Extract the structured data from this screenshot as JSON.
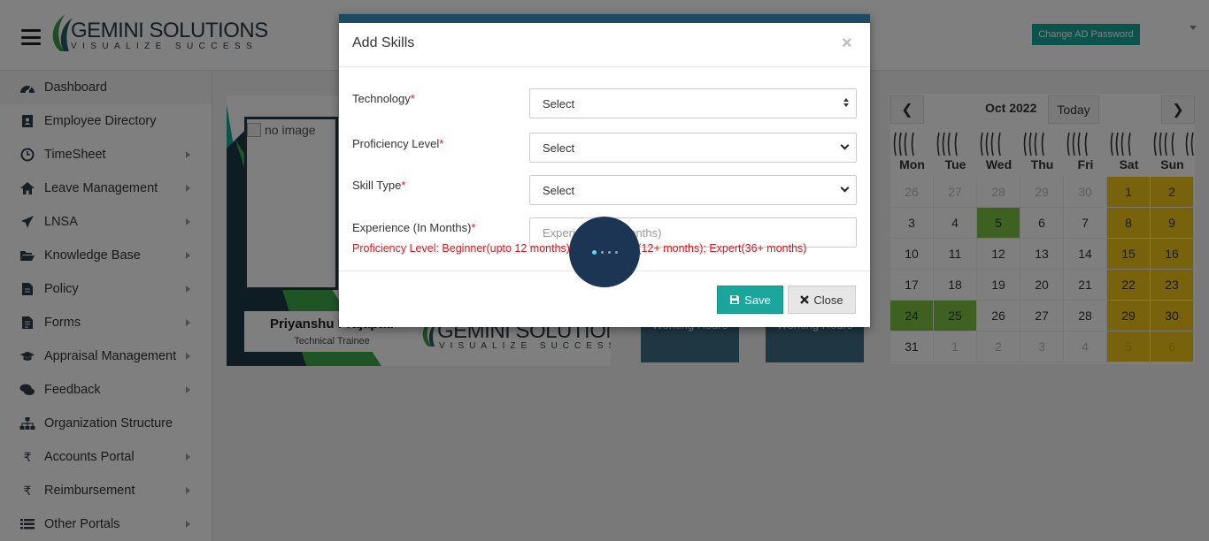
{
  "header": {
    "brand": "GEMINI SOLUTIONS",
    "tagline": "VISUALIZE SUCCESS",
    "change_password_label": "Change AD Password"
  },
  "sidebar": {
    "items": [
      {
        "label": "Dashboard",
        "icon": "dashboard-icon",
        "has_submenu": false
      },
      {
        "label": "Employee Directory",
        "icon": "address-book-icon",
        "has_submenu": false
      },
      {
        "label": "TimeSheet",
        "icon": "clock-icon",
        "has_submenu": true
      },
      {
        "label": "Leave Management",
        "icon": "home-icon",
        "has_submenu": true
      },
      {
        "label": "LNSA",
        "icon": "paper-plane-icon",
        "has_submenu": true
      },
      {
        "label": "Knowledge Base",
        "icon": "folder-open-icon",
        "has_submenu": true
      },
      {
        "label": "Policy",
        "icon": "file-icon",
        "has_submenu": true
      },
      {
        "label": "Forms",
        "icon": "file-text-icon",
        "has_submenu": true
      },
      {
        "label": "Appraisal Management",
        "icon": "graduation-cap-icon",
        "has_submenu": true
      },
      {
        "label": "Feedback",
        "icon": "comments-icon",
        "has_submenu": true
      },
      {
        "label": "Organization Structure",
        "icon": "sitemap-icon",
        "has_submenu": false
      },
      {
        "label": "Accounts Portal",
        "icon": "rupee-icon",
        "has_submenu": true
      },
      {
        "label": "Reimbursement",
        "icon": "rupee-icon",
        "has_submenu": true
      },
      {
        "label": "Other Portals",
        "icon": "list-icon",
        "has_submenu": true
      }
    ]
  },
  "profile": {
    "photo_alt": "no image",
    "name": "Priyanshu Prajapati",
    "role": "Technical Trainee"
  },
  "tiles": [
    {
      "label": "Working Hours"
    },
    {
      "label": "Working Hours"
    }
  ],
  "calendar": {
    "month_label": "Oct 2022",
    "today_label": "Today",
    "prev_glyph": "❮",
    "next_glyph": "❯",
    "weekdays": [
      "Mon",
      "Tue",
      "Wed",
      "Thu",
      "Fri",
      "Sat",
      "Sun"
    ],
    "colors": {
      "weekend": "#f0c419",
      "highlight": "#7dc242"
    },
    "weeks": [
      [
        {
          "d": "26",
          "other": true
        },
        {
          "d": "27",
          "other": true
        },
        {
          "d": "28",
          "other": true
        },
        {
          "d": "29",
          "other": true
        },
        {
          "d": "30",
          "other": true
        },
        {
          "d": "1",
          "weekend": true
        },
        {
          "d": "2",
          "weekend": true
        }
      ],
      [
        {
          "d": "3"
        },
        {
          "d": "4"
        },
        {
          "d": "5",
          "highlight": true
        },
        {
          "d": "6"
        },
        {
          "d": "7"
        },
        {
          "d": "8",
          "weekend": true
        },
        {
          "d": "9",
          "weekend": true
        }
      ],
      [
        {
          "d": "10"
        },
        {
          "d": "11"
        },
        {
          "d": "12"
        },
        {
          "d": "13"
        },
        {
          "d": "14"
        },
        {
          "d": "15",
          "weekend": true
        },
        {
          "d": "16",
          "weekend": true
        }
      ],
      [
        {
          "d": "17"
        },
        {
          "d": "18"
        },
        {
          "d": "19"
        },
        {
          "d": "20"
        },
        {
          "d": "21"
        },
        {
          "d": "22",
          "weekend": true
        },
        {
          "d": "23",
          "weekend": true
        }
      ],
      [
        {
          "d": "24",
          "highlight": true
        },
        {
          "d": "25",
          "highlight": true
        },
        {
          "d": "26"
        },
        {
          "d": "27"
        },
        {
          "d": "28"
        },
        {
          "d": "29",
          "weekend": true
        },
        {
          "d": "30",
          "weekend": true
        }
      ],
      [
        {
          "d": "31"
        },
        {
          "d": "1",
          "other": true
        },
        {
          "d": "2",
          "other": true
        },
        {
          "d": "3",
          "other": true
        },
        {
          "d": "4",
          "other": true
        },
        {
          "d": "5",
          "other": true,
          "weekend": true
        },
        {
          "d": "6",
          "other": true,
          "weekend": true
        }
      ]
    ]
  },
  "modal": {
    "title": "Add Skills",
    "close_glyph": "×",
    "fields": {
      "technology": {
        "label": "Technology",
        "required_mark": "*",
        "value": "Select"
      },
      "proficiency": {
        "label": "Proficiency Level",
        "required_mark": "*",
        "value": "Select"
      },
      "skill_type": {
        "label": "Skill Type",
        "required_mark": "*",
        "value": "Select"
      },
      "experience": {
        "label": "Experience (In Months)",
        "required_mark": "*",
        "placeholder": "Experience (In Months)"
      }
    },
    "hint": "Proficiency Level: Beginner(upto 12 months); Intermediate(12+ months); Expert(36+ months)",
    "save_label": "Save",
    "close_label": "Close"
  }
}
